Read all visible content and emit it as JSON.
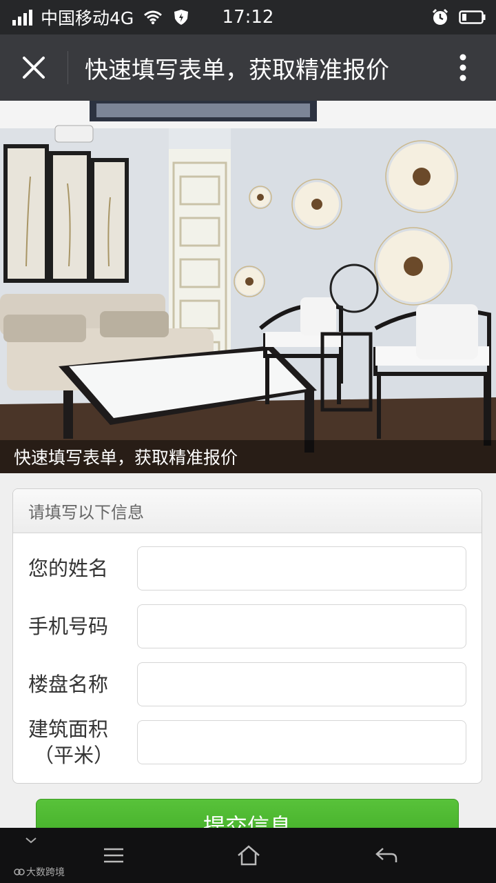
{
  "status_bar": {
    "carrier": "中国移动4G",
    "time": "17:12"
  },
  "title_bar": {
    "title": "快速填写表单，获取精准报价",
    "close_icon": "close-icon",
    "more_icon": "more-vertical-icon"
  },
  "banner": {
    "caption": "快速填写表单，获取精准报价"
  },
  "form": {
    "header": "请填写以下信息",
    "fields": [
      {
        "label": "您的姓名",
        "value": ""
      },
      {
        "label": "手机号码",
        "value": ""
      },
      {
        "label": "楼盘名称",
        "value": ""
      },
      {
        "label": "建筑面积",
        "label_sub": "（平米）",
        "value": ""
      }
    ],
    "submit_label": "提交信息"
  },
  "nav_bar": {
    "watermark": "大数跨境"
  },
  "colors": {
    "title_bar_bg": "#393a3e",
    "status_bar_bg": "#262729",
    "submit_green": "#4bb52f",
    "page_bg": "#efefef"
  }
}
